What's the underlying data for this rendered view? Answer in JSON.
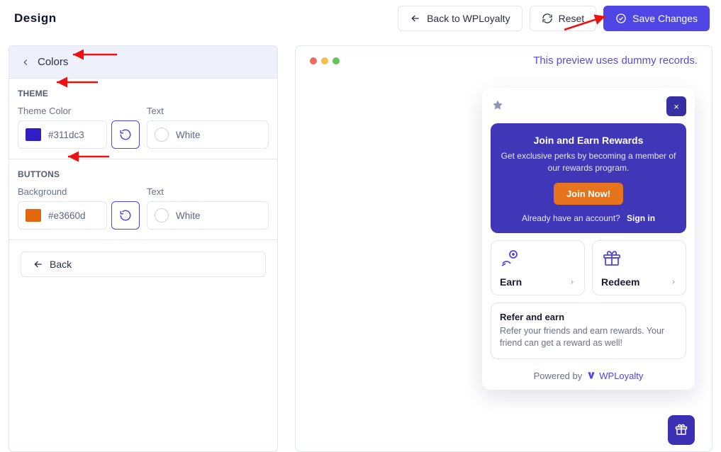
{
  "header": {
    "title": "Design",
    "back_btn": "Back to WPLoyalty",
    "reset_btn": "Reset",
    "save_btn": "Save Changes"
  },
  "panel": {
    "title": "Colors",
    "theme_section": "THEME",
    "buttons_section": "BUTTONS",
    "theme_color_label": "Theme Color",
    "text_label": "Text",
    "background_label": "Background",
    "theme_color_value": "#311dc3",
    "theme_text_value": "White",
    "button_bg_value": "#e3660d",
    "button_text_value": "White",
    "back_btn": "Back"
  },
  "preview": {
    "note": "This preview uses dummy records."
  },
  "widget": {
    "hero_title": "Join and Earn Rewards",
    "hero_sub": "Get exclusive perks by becoming a member of our rewards program.",
    "join_btn": "Join Now!",
    "signin_prompt": "Already have an account?",
    "signin_link": "Sign in",
    "earn_label": "Earn",
    "redeem_label": "Redeem",
    "refer_title": "Refer and earn",
    "refer_sub": "Refer your friends and earn rewards. Your friend can get a reward as well!",
    "powered_prefix": "Powered by",
    "powered_brand": "WPLoyalty"
  },
  "colors": {
    "theme": "#311dc3",
    "button_bg": "#e3660d"
  }
}
